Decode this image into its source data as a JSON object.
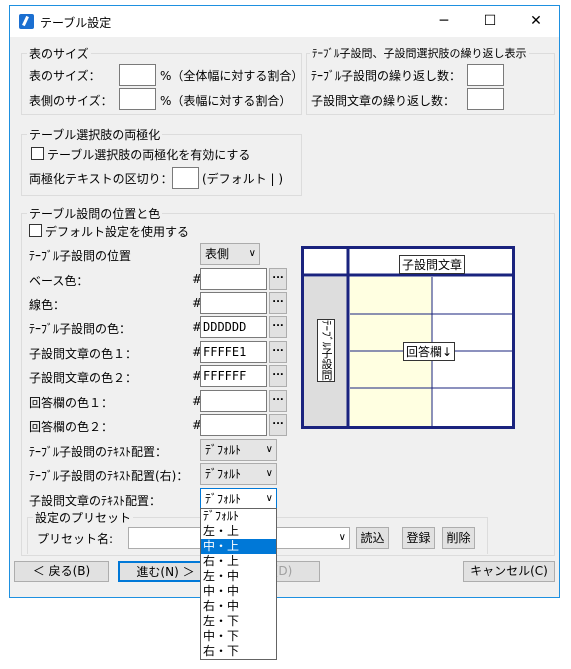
{
  "window": {
    "title": "テーブル設定",
    "minimize": "─",
    "maximize": "☐",
    "close": "✕"
  },
  "table_size": {
    "group_title": "表のサイズ",
    "size_label": "表のサイズ：",
    "size_unit": "%（全体幅に対する割合）",
    "side_label": "表側のサイズ：",
    "side_unit": "%（表幅に対する割合）"
  },
  "repeat": {
    "group_title": "ﾃｰﾌﾞﾙ子設問、子設問選択肢の繰り返し表示",
    "child_label": "ﾃｰﾌﾞﾙ子設問の繰り返し数：",
    "text_label": "子設問文章の繰り返し数："
  },
  "polarize": {
    "group_title": "テーブル選択肢の両極化",
    "enable_label": "テーブル選択肢の両極化を有効にする",
    "sep_label": "両極化テキストの区切り：",
    "sep_default": "(デフォルト | )"
  },
  "position_color": {
    "group_title": "テーブル設問の位置と色",
    "use_default": "デフォルト設定を使用する",
    "pos_label": "ﾃｰﾌﾞﾙ子設問の位置",
    "pos_value": "表側",
    "hash": "#",
    "dots": "...",
    "colors": [
      {
        "label": "ベース色：",
        "value": ""
      },
      {
        "label": "線色：",
        "value": ""
      },
      {
        "label": "ﾃｰﾌﾞﾙ子設問の色：",
        "value": "DDDDDD"
      },
      {
        "label": "子設問文章の色１：",
        "value": "FFFFE1"
      },
      {
        "label": "子設問文章の色２：",
        "value": "FFFFFF"
      },
      {
        "label": "回答欄の色１：",
        "value": ""
      },
      {
        "label": "回答欄の色２：",
        "value": ""
      }
    ],
    "align": [
      {
        "label": "ﾃｰﾌﾞﾙ子設問のﾃｷｽﾄ配置：",
        "value": "ﾃﾞﾌｫﾙﾄ"
      },
      {
        "label": "ﾃｰﾌﾞﾙ子設問のﾃｷｽﾄ配置(右)：",
        "value": "ﾃﾞﾌｫﾙﾄ"
      },
      {
        "label": "子設問文章のﾃｷｽﾄ配置：",
        "value": "ﾃﾞﾌｫﾙﾄ"
      }
    ]
  },
  "preview": {
    "col_header": "子設問文章",
    "row_header": "ﾃｰﾌﾞﾙ子設問",
    "answer_label": "回答欄↓",
    "colors": {
      "border": "#1a237e",
      "child": "#dddddd",
      "text1": "#ffffe1",
      "text2": "#ffffff"
    }
  },
  "preset": {
    "group_title": "設定のプリセット",
    "name_label": "プリセット名:",
    "load": "読込",
    "save": "登録",
    "delete": "削除"
  },
  "footer": {
    "back": "＜ 戻る(B)",
    "next": "進む(N) ＞",
    "complete": "完了(D)",
    "cancel": "キャンセル(C)"
  },
  "dropdown": {
    "options": [
      "ﾃﾞﾌｫﾙﾄ",
      "左・上",
      "中・上",
      "右・上",
      "左・中",
      "中・中",
      "右・中",
      "左・下",
      "中・下",
      "右・下"
    ],
    "selected": "中・上"
  }
}
